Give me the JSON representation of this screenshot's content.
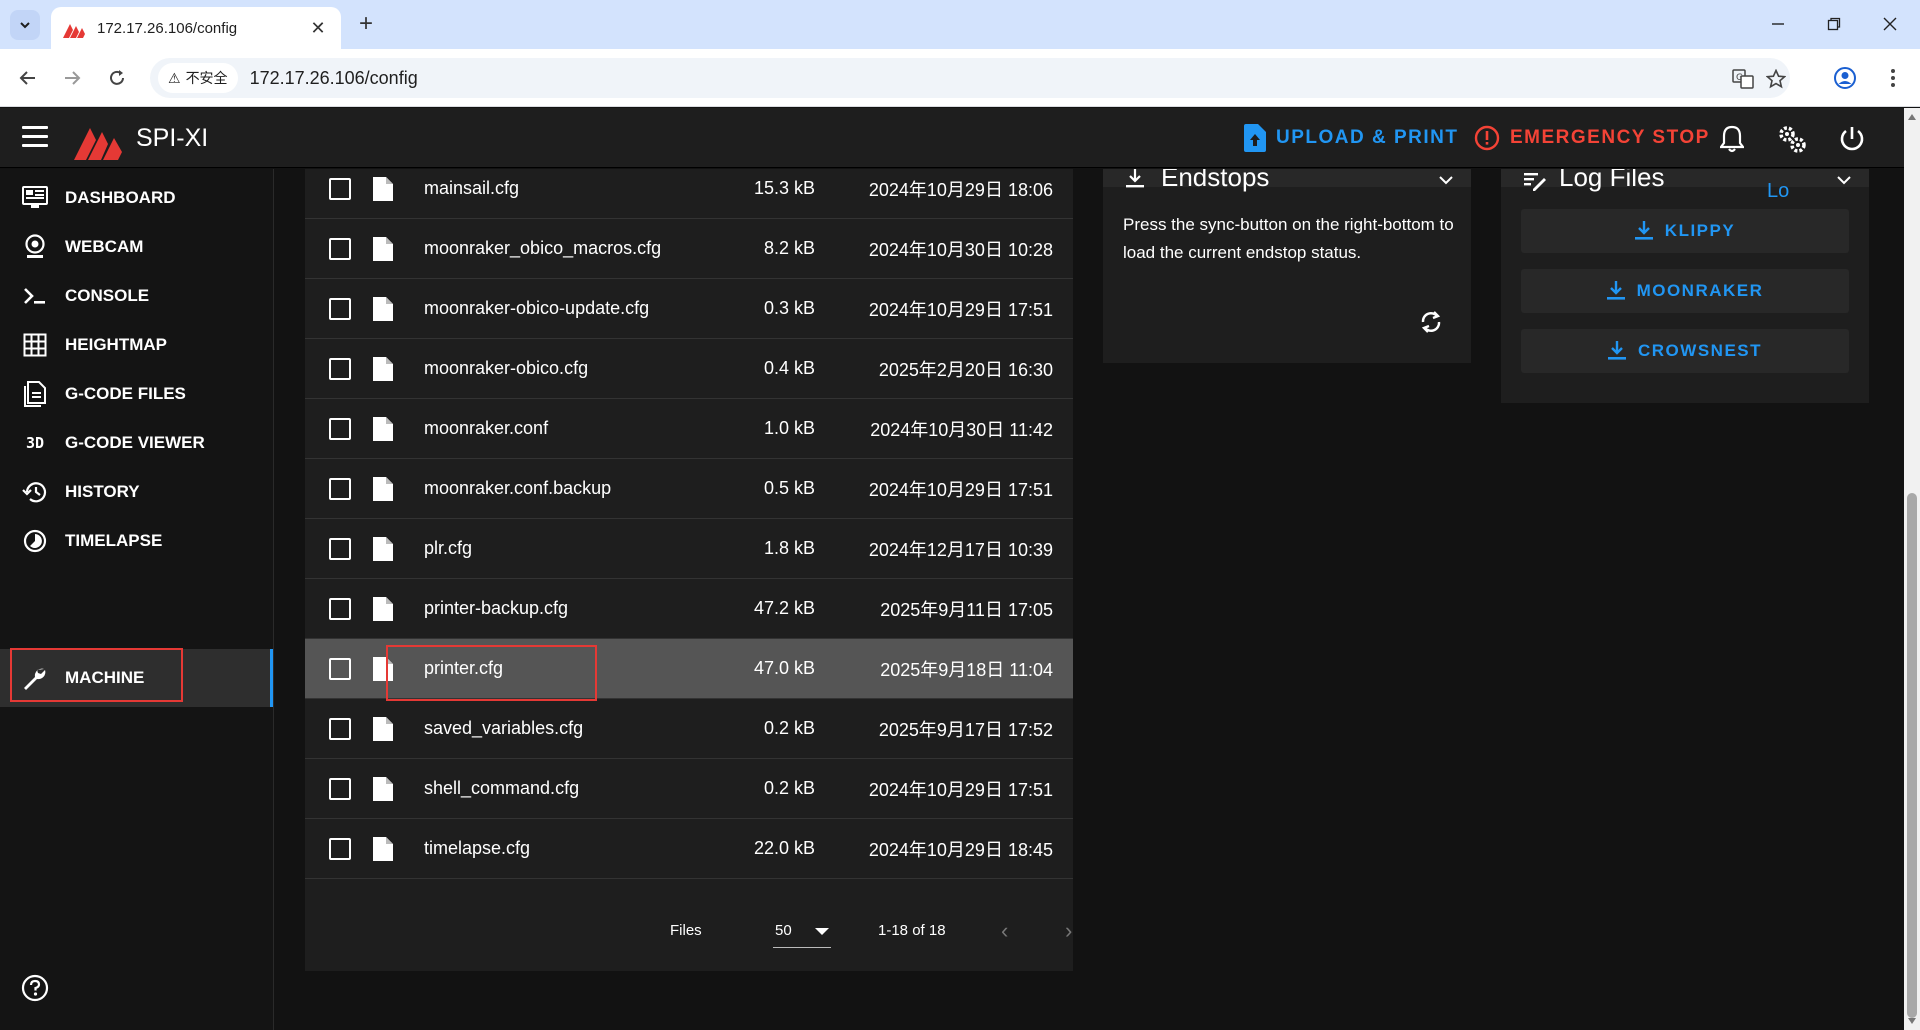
{
  "browser": {
    "tab_title": "172.17.26.106/config",
    "security_label": "不安全",
    "url": "172.17.26.106/config"
  },
  "appbar": {
    "brand": "SPI-XI",
    "upload_label": "UPLOAD & PRINT",
    "estop_label": "EMERGENCY STOP"
  },
  "sidebar": {
    "items": [
      {
        "label": "DASHBOARD",
        "icon": "monitor-dashboard-icon"
      },
      {
        "label": "WEBCAM",
        "icon": "webcam-icon"
      },
      {
        "label": "CONSOLE",
        "icon": "console-icon"
      },
      {
        "label": "HEIGHTMAP",
        "icon": "grid-icon"
      },
      {
        "label": "G-CODE FILES",
        "icon": "file-document-icon"
      },
      {
        "label": "G-CODE VIEWER",
        "icon": "3d-icon"
      },
      {
        "label": "HISTORY",
        "icon": "history-icon"
      },
      {
        "label": "TIMELAPSE",
        "icon": "timelapse-icon"
      },
      {
        "label": "MACHINE",
        "icon": "wrench-icon"
      }
    ],
    "active": "MACHINE",
    "viewer_glyph": "3D"
  },
  "files": {
    "rows": [
      {
        "name": "mainsail.cfg",
        "size": "15.3 kB",
        "date": "2024年10月29日 18:06"
      },
      {
        "name": "moonraker_obico_macros.cfg",
        "size": "8.2 kB",
        "date": "2024年10月30日 10:28"
      },
      {
        "name": "moonraker-obico-update.cfg",
        "size": "0.3 kB",
        "date": "2024年10月29日 17:51"
      },
      {
        "name": "moonraker-obico.cfg",
        "size": "0.4 kB",
        "date": "2025年2月20日 16:30"
      },
      {
        "name": "moonraker.conf",
        "size": "1.0 kB",
        "date": "2024年10月30日 11:42"
      },
      {
        "name": "moonraker.conf.backup",
        "size": "0.5 kB",
        "date": "2024年10月29日 17:51"
      },
      {
        "name": "plr.cfg",
        "size": "1.8 kB",
        "date": "2024年12月17日 10:39"
      },
      {
        "name": "printer-backup.cfg",
        "size": "47.2 kB",
        "date": "2025年9月11日 17:05"
      },
      {
        "name": "printer.cfg",
        "size": "47.0 kB",
        "date": "2025年9月18日 11:04"
      },
      {
        "name": "saved_variables.cfg",
        "size": "0.2 kB",
        "date": "2025年9月17日 17:52"
      },
      {
        "name": "shell_command.cfg",
        "size": "0.2 kB",
        "date": "2024年10月29日 17:51"
      },
      {
        "name": "timelapse.cfg",
        "size": "22.0 kB",
        "date": "2024年10月29日 18:45"
      }
    ],
    "selected": "printer.cfg",
    "footer": {
      "files_label": "Files",
      "per_page": "50",
      "range": "1-18 of 18"
    }
  },
  "endstops": {
    "title": "Endstops",
    "text": "Press the sync-button on the right-bottom to load the current endstop status."
  },
  "logfiles": {
    "title": "Log Files",
    "header_fragment": "Lo",
    "buttons": [
      "KLIPPY",
      "MOONRAKER",
      "CROWSNEST"
    ]
  },
  "colors": {
    "accent": "#2196f3",
    "danger": "#f44336",
    "highlight": "#e53935"
  }
}
